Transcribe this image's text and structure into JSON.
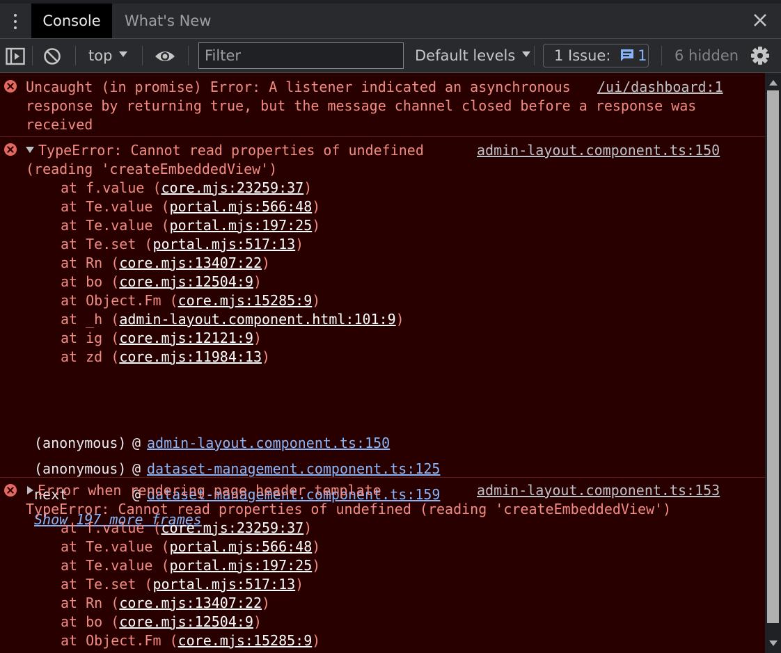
{
  "tabs": [
    {
      "label": "Console",
      "active": true
    },
    {
      "label": "What's New",
      "active": false
    }
  ],
  "toolbar": {
    "context": "top",
    "filter_placeholder": "Filter",
    "levels": "Default levels",
    "issues_label": "1 Issue:",
    "issues_count": "1",
    "hidden": "6 hidden"
  },
  "colors": {
    "error_bg": "#290000",
    "error_text": "#f28b82",
    "link_blue": "#8ab4f8",
    "toolbar_bg": "#292a2d"
  },
  "messages": [
    {
      "lines": [
        "Uncaught (in promise) Error: A listener indicated an asynchronous",
        "response by returning true, but the message channel closed before a response was",
        "received"
      ],
      "source": "/ui/dashboard:1"
    },
    {
      "lines": [
        "TypeError: Cannot read properties of undefined",
        "(reading 'createEmbeddedView')"
      ],
      "source": "admin-layout.component.ts:150",
      "stack": [
        {
          "fn": "at f.value",
          "loc": "core.mjs:23259:37"
        },
        {
          "fn": "at Te.value",
          "loc": "portal.mjs:566:48"
        },
        {
          "fn": "at Te.value",
          "loc": "portal.mjs:197:25"
        },
        {
          "fn": "at Te.set",
          "loc": "portal.mjs:517:13"
        },
        {
          "fn": "at Rn",
          "loc": "core.mjs:13407:22"
        },
        {
          "fn": "at bo",
          "loc": "core.mjs:12504:9"
        },
        {
          "fn": "at Object.Fm",
          "loc": "core.mjs:15285:9"
        },
        {
          "fn": "at _h",
          "loc": "admin-layout.component.html:101:9"
        },
        {
          "fn": "at ig",
          "loc": "core.mjs:12121:9"
        },
        {
          "fn": "at zd",
          "loc": "core.mjs:11984:13"
        }
      ],
      "frames": [
        {
          "name": "(anonymous)",
          "at": "@",
          "link": "admin-layout.component.ts:150"
        },
        {
          "name": "(anonymous)",
          "at": "@",
          "link": "dataset-management.component.ts:125"
        },
        {
          "name": "next",
          "at": "@",
          "link": "dataset-management.component.ts:159"
        }
      ],
      "more": "Show 197 more frames"
    },
    {
      "lines": [
        "Error when rendering page header template",
        "TypeError: Cannot read properties of undefined (reading 'createEmbeddedView')"
      ],
      "source": "admin-layout.component.ts:153",
      "stack": [
        {
          "fn": "at f.value",
          "loc": "core.mjs:23259:37"
        },
        {
          "fn": "at Te.value",
          "loc": "portal.mjs:566:48"
        },
        {
          "fn": "at Te.value",
          "loc": "portal.mjs:197:25"
        },
        {
          "fn": "at Te.set",
          "loc": "portal.mjs:517:13"
        },
        {
          "fn": "at Rn",
          "loc": "core.mjs:13407:22"
        },
        {
          "fn": "at bo",
          "loc": "core.mjs:12504:9"
        },
        {
          "fn": "at Object.Fm",
          "loc": "core.mjs:15285:9"
        }
      ]
    }
  ]
}
